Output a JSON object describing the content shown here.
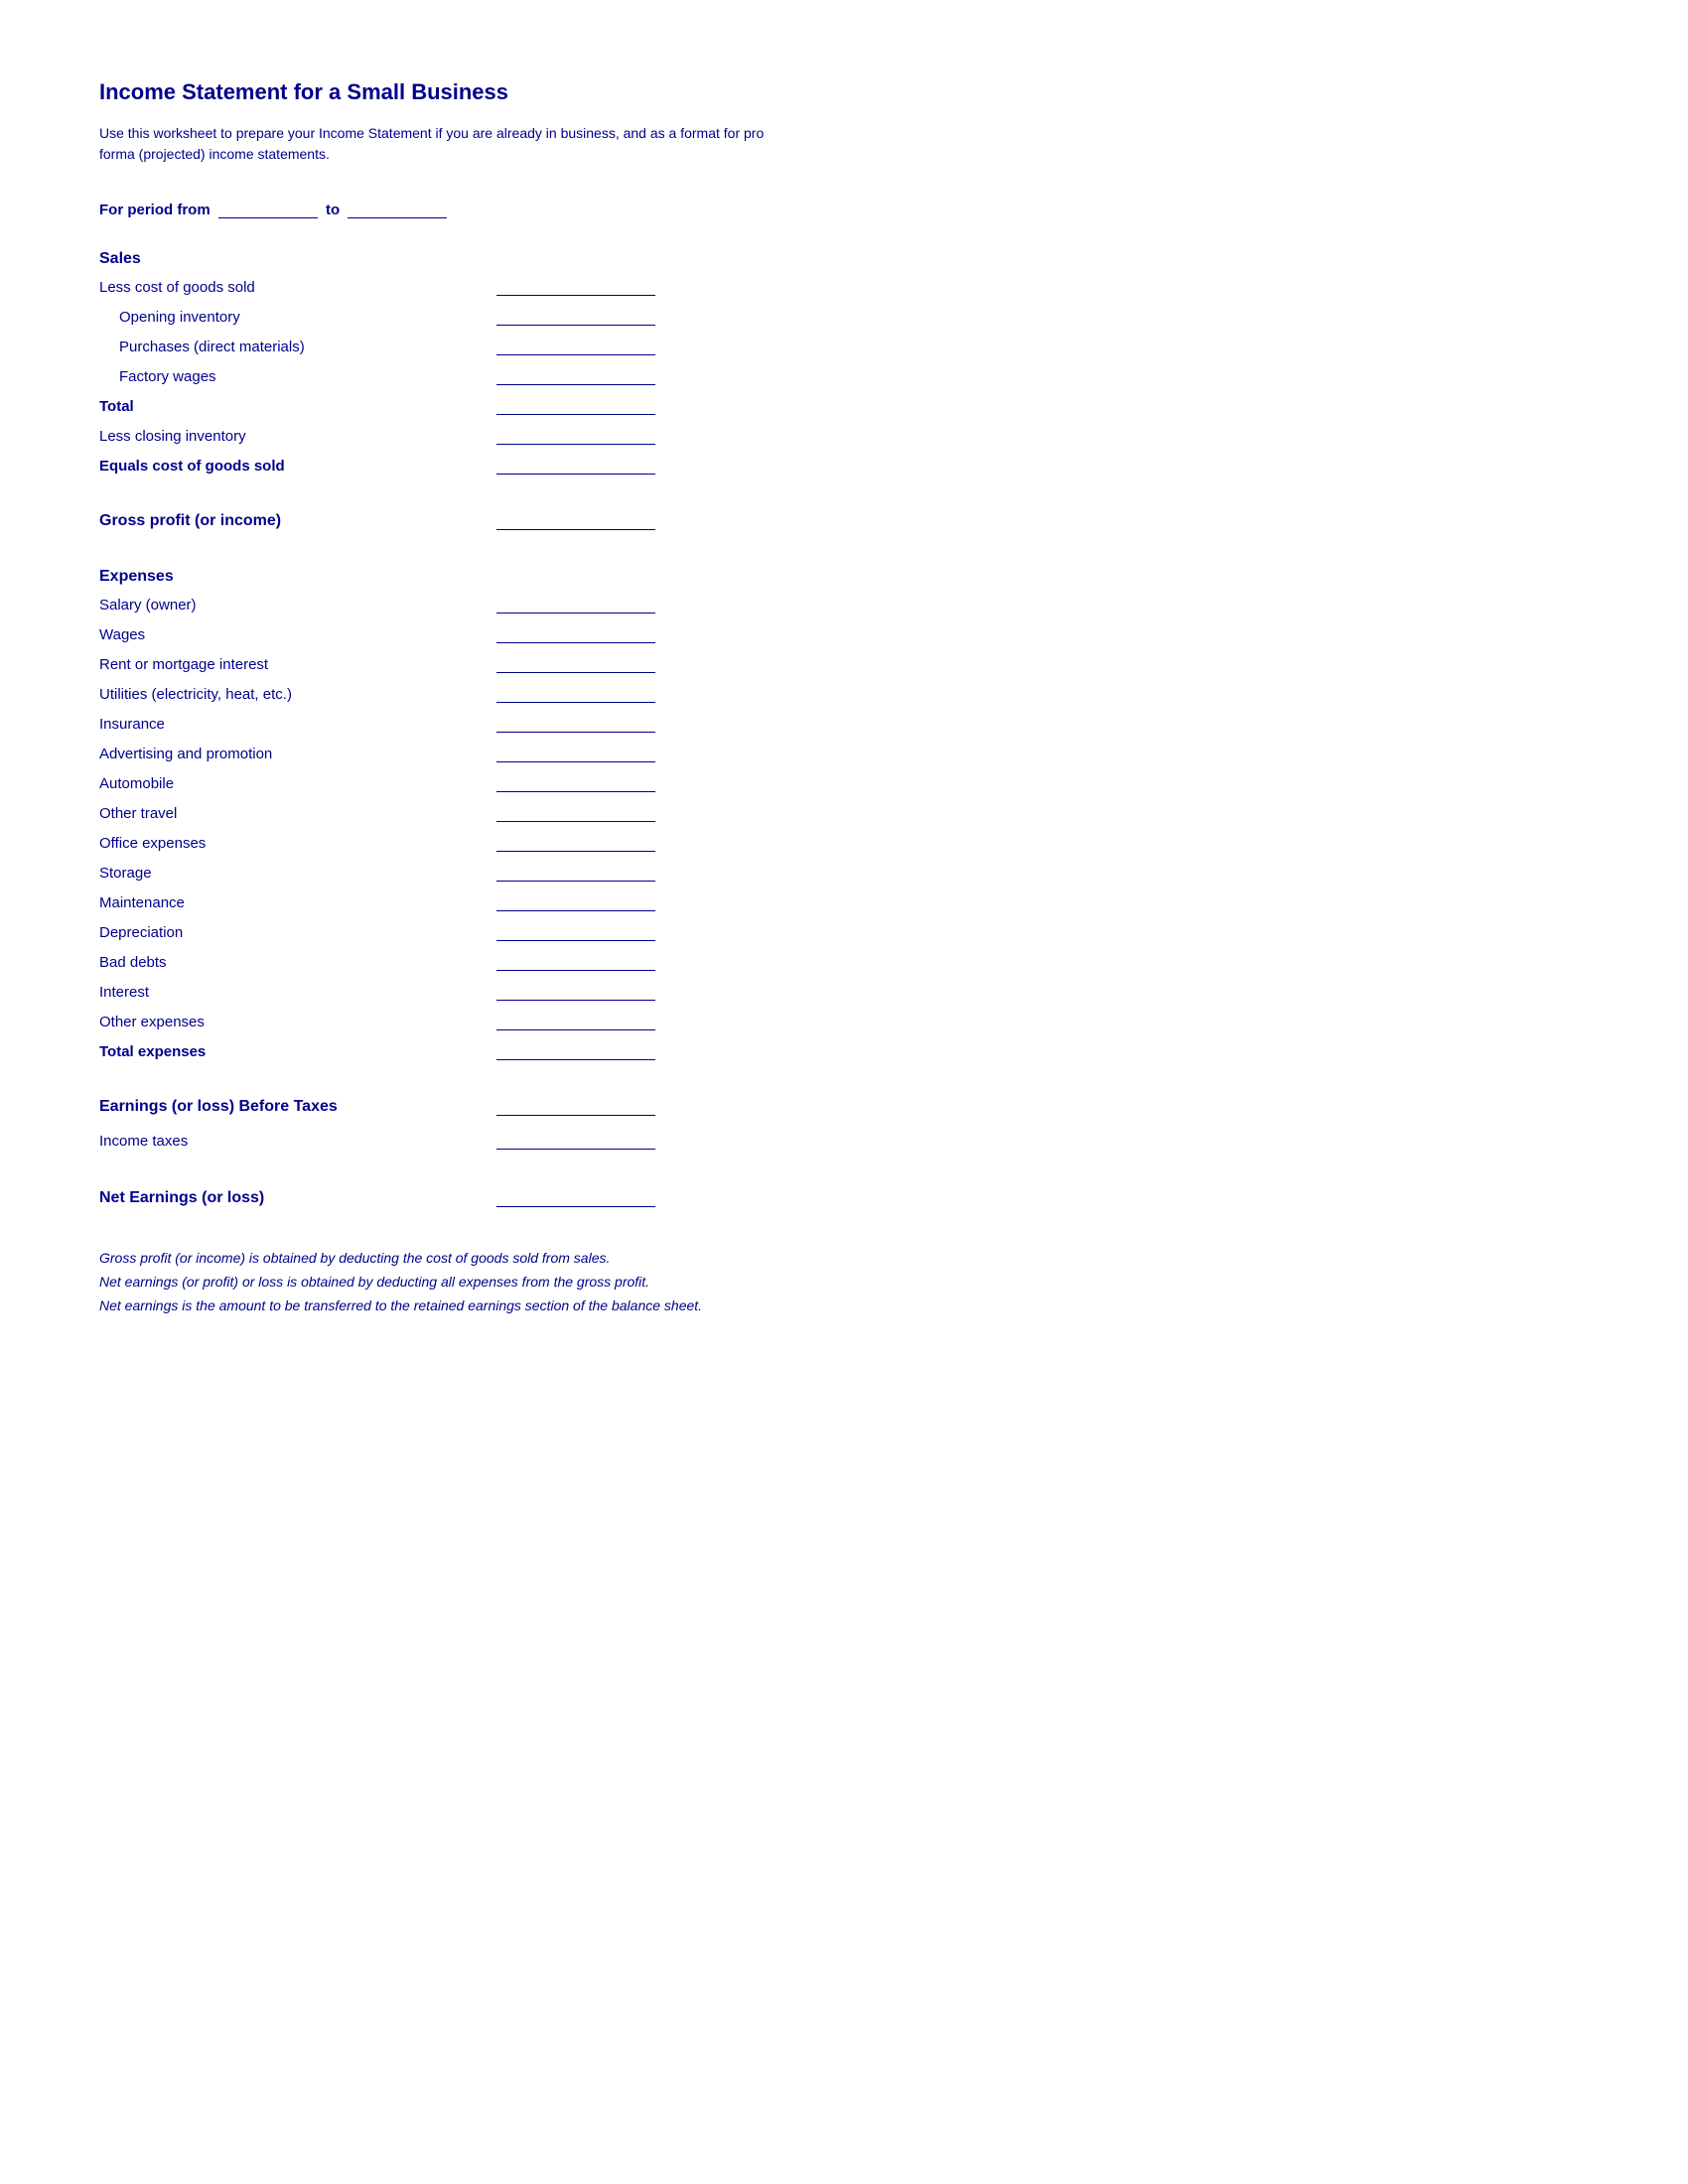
{
  "title": "Income Statement for a Small Business",
  "description": "Use this worksheet to prepare your Income Statement if you are already in business, and as a format for pro forma (projected) income statements.",
  "period_label": "For period from",
  "period_to": "to",
  "sections": {
    "sales": {
      "header": "Sales",
      "rows": [
        {
          "label": "Less cost of goods sold",
          "indent": false,
          "bold": false,
          "has_field": false
        },
        {
          "label": "Opening inventory",
          "indent": true,
          "bold": false,
          "has_field": true
        },
        {
          "label": "Purchases (direct materials)",
          "indent": true,
          "bold": false,
          "has_field": true
        },
        {
          "label": "Factory wages",
          "indent": true,
          "bold": false,
          "has_field": true
        },
        {
          "label": "Total",
          "indent": false,
          "bold": true,
          "has_field": true
        },
        {
          "label": "Less closing inventory",
          "indent": false,
          "bold": false,
          "has_field": true
        },
        {
          "label": "Equals cost of goods sold",
          "indent": false,
          "bold": true,
          "has_field": true
        }
      ]
    },
    "gross_profit": {
      "label": "Gross profit (or income)"
    },
    "expenses": {
      "header": "Expenses",
      "rows": [
        {
          "label": "Salary (owner)",
          "has_field": false
        },
        {
          "label": "Wages",
          "has_field": true
        },
        {
          "label": "Rent or mortgage interest",
          "has_field": true
        },
        {
          "label": "Utilities (electricity, heat, etc.)",
          "has_field": true
        },
        {
          "label": "Insurance",
          "has_field": true
        },
        {
          "label": "Advertising and promotion",
          "has_field": true
        },
        {
          "label": "Automobile",
          "has_field": true
        },
        {
          "label": "Other travel",
          "has_field": true
        },
        {
          "label": "Office expenses",
          "has_field": true
        },
        {
          "label": "Storage",
          "has_field": true
        },
        {
          "label": "Maintenance",
          "has_field": true
        },
        {
          "label": "Depreciation",
          "has_field": true
        },
        {
          "label": "Bad debts",
          "has_field": true
        },
        {
          "label": "Interest",
          "has_field": true
        },
        {
          "label": "Other expenses",
          "has_field": true
        },
        {
          "label": "Total expenses",
          "bold": true,
          "has_field": false
        }
      ]
    },
    "earnings_before_taxes": {
      "label": "Earnings (or loss) Before Taxes",
      "bold": true
    },
    "income_taxes": {
      "label": "Income taxes"
    },
    "net_earnings": {
      "label": "Net Earnings (or loss)",
      "bold": true
    }
  },
  "footnotes": [
    "Gross profit (or income) is obtained by deducting the cost of goods sold from sales.",
    "Net earnings (or profit) or loss is obtained by deducting all expenses from the gross profit.",
    "Net earnings is the amount to be transferred to the retained earnings section of the balance sheet."
  ]
}
